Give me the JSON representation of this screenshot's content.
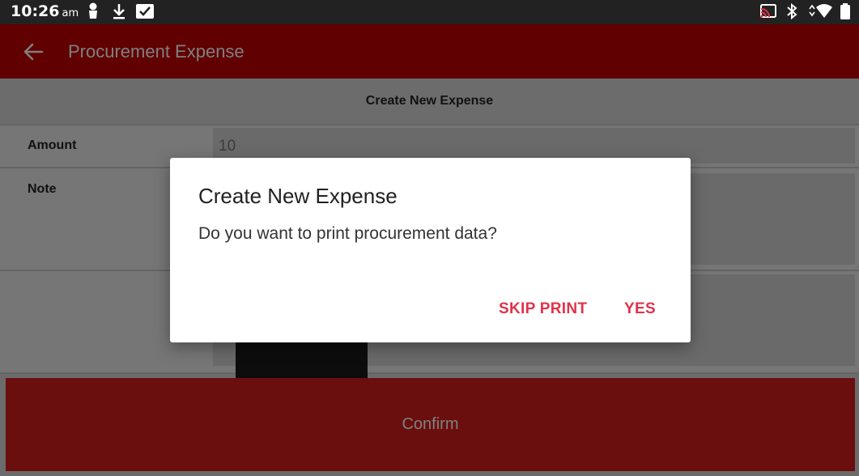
{
  "status_bar": {
    "time": "10:26",
    "ampm": "am",
    "icons": [
      "person-icon",
      "download-icon",
      "checkbox-notification-icon",
      "cast-icon",
      "bluetooth-icon",
      "wifi-icon",
      "battery-icon"
    ]
  },
  "app_bar": {
    "title": "Procurement Expense",
    "color": "#c00000"
  },
  "form": {
    "header": "Create New Expense",
    "amount_label": "Amount",
    "amount_value": "10",
    "note_label": "Note",
    "note_value": ""
  },
  "confirm_label": "Confirm",
  "dialog": {
    "title": "Create New Expense",
    "message": "Do you want to print procurement data?",
    "skip_label": "SKIP PRINT",
    "yes_label": "YES",
    "accent": "#e0334a"
  }
}
